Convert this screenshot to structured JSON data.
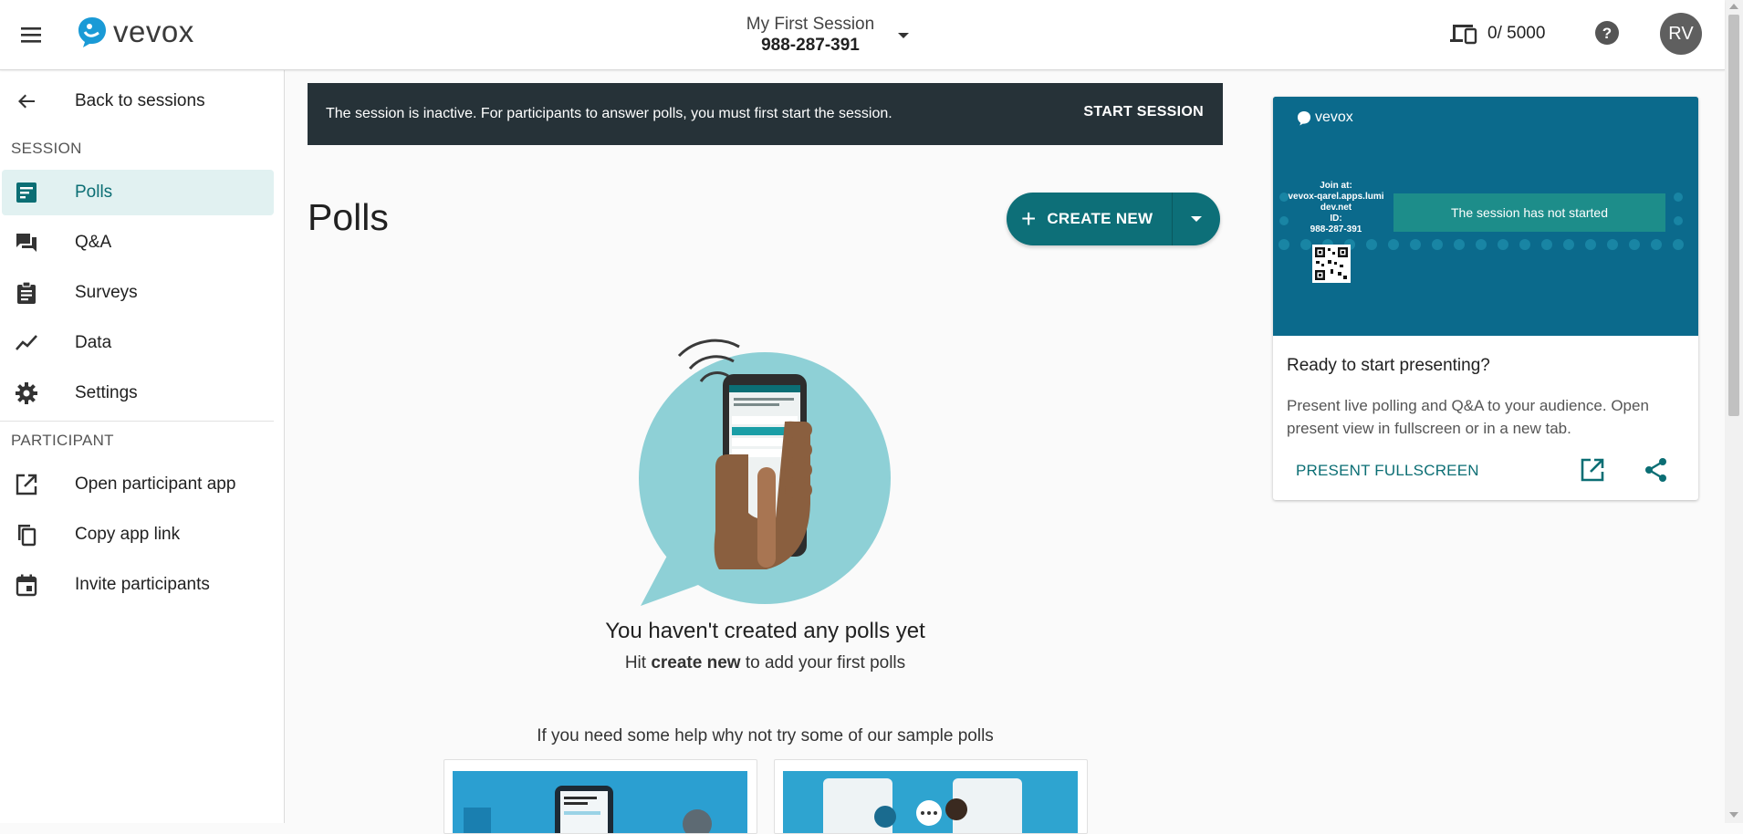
{
  "header": {
    "logo_text": "vevox",
    "session_name": "My First Session",
    "session_id": "988-287-391",
    "devices_count": "0/ 5000",
    "avatar_initials": "RV"
  },
  "sidebar": {
    "back_label": "Back to sessions",
    "session_heading": "SESSION",
    "session_items": [
      {
        "label": "Polls",
        "icon": "poll-icon",
        "active": true
      },
      {
        "label": "Q&A",
        "icon": "forum-icon"
      },
      {
        "label": "Surveys",
        "icon": "clipboard-icon"
      },
      {
        "label": "Data",
        "icon": "trend-icon"
      },
      {
        "label": "Settings",
        "icon": "gear-icon"
      }
    ],
    "participant_heading": "PARTICIPANT",
    "participant_items": [
      {
        "label": "Open participant app",
        "icon": "open-external-icon"
      },
      {
        "label": "Copy app link",
        "icon": "copy-icon"
      },
      {
        "label": "Invite participants",
        "icon": "calendar-icon"
      }
    ]
  },
  "banner": {
    "text": "The session is inactive. For participants to answer polls, you must first start the session.",
    "action": "START SESSION"
  },
  "main": {
    "title": "Polls",
    "create_label": "CREATE NEW",
    "empty_title": "You haven't created any polls yet",
    "empty_sub_pre": "Hit ",
    "empty_sub_bold": "create new",
    "empty_sub_post": " to add your first polls",
    "sample_heading": "If you need some help why not try some of our sample polls"
  },
  "preview": {
    "logo_text": "vevox",
    "join_at": "Join at:",
    "join_url": "vevox-qarel.apps.lumi dev.net",
    "id_label": "ID:",
    "id_value": "988-287-391",
    "status": "The session has not started",
    "title": "Ready to start presenting?",
    "description": "Present live polling and Q&A to your audience. Open present view in fullscreen or in a new tab.",
    "present_label": "PRESENT FULLSCREEN"
  },
  "colors": {
    "accent": "#0d6f78",
    "banner_bg": "#263238",
    "active_nav_bg": "#e1f1f1",
    "preview_bg": "#0b6a8c"
  }
}
